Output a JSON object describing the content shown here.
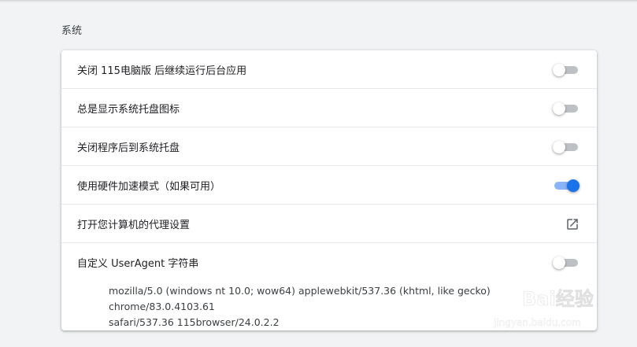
{
  "section": {
    "title": "系统"
  },
  "settings": [
    {
      "label": "关闭 115电脑版 后继续运行后台应用",
      "control": "toggle",
      "checked": false
    },
    {
      "label": "总是显示系统托盘图标",
      "control": "toggle",
      "checked": false
    },
    {
      "label": "关闭程序后到系统托盘",
      "control": "toggle",
      "checked": false
    },
    {
      "label": "使用硬件加速模式（如果可用）",
      "control": "toggle",
      "checked": true
    },
    {
      "label": "打开您计算机的代理设置",
      "control": "open-in-new-icon"
    },
    {
      "label": "自定义 UserAgent 字符串",
      "control": "toggle",
      "checked": false
    }
  ],
  "user_agent": {
    "line1": "mozilla/5.0 (windows nt 10.0; wow64) applewebkit/537.36 (khtml, like gecko) chrome/83.0.4103.61",
    "line2": "safari/537.36 115browser/24.0.2.2"
  },
  "watermark": {
    "logo_text": "Bai经验",
    "url_text": "jingyan.baidu.com"
  },
  "colors": {
    "accent": "#1a73e8",
    "accent_track": "#8ab4f8",
    "toggle_off_track": "#bdc1c6",
    "page_bg": "#f1f3f4"
  }
}
